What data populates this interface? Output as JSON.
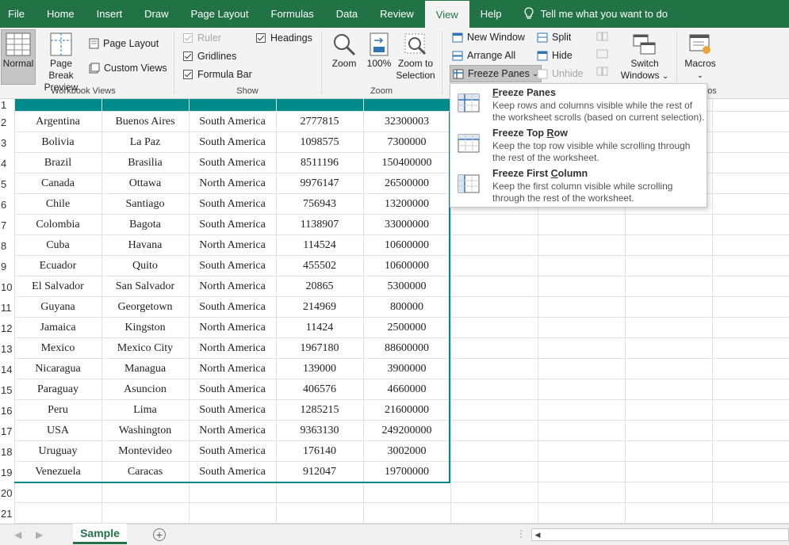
{
  "tabs": [
    "File",
    "Home",
    "Insert",
    "Draw",
    "Page Layout",
    "Formulas",
    "Data",
    "Review",
    "View",
    "Help"
  ],
  "active_tab": "View",
  "tell_me": "Tell me what you want to do",
  "ribbon": {
    "workbook_views": {
      "label": "Workbook Views",
      "normal": "Normal",
      "page_break_1": "Page Break",
      "page_break_2": "Preview",
      "page_layout": "Page Layout",
      "custom_views": "Custom Views"
    },
    "show": {
      "label": "Show",
      "ruler": "Ruler",
      "gridlines": "Gridlines",
      "formula_bar": "Formula Bar",
      "headings": "Headings"
    },
    "zoom": {
      "label": "Zoom",
      "zoom": "Zoom",
      "hundred": "100%",
      "zoom_sel_1": "Zoom to",
      "zoom_sel_2": "Selection"
    },
    "window": {
      "new_window": "New Window",
      "arrange_all": "Arrange All",
      "freeze_panes": "Freeze Panes",
      "split": "Split",
      "hide": "Hide",
      "unhide": "Unhide",
      "switch_1": "Switch",
      "switch_2": "Windows",
      "chevron": "⌄"
    },
    "macros": {
      "label_partial": "os",
      "macros": "Macros",
      "chevron": "⌄"
    }
  },
  "dropdown": [
    {
      "title": "Freeze Panes",
      "underline_char": "F",
      "title_rest": "reeze Panes",
      "desc": "Keep rows and columns visible while the rest of the worksheet scrolls (based on current selection)."
    },
    {
      "title": "Freeze Top Row",
      "title_pre": "Freeze Top ",
      "underline_char": "R",
      "title_rest": "ow",
      "desc": "Keep the top row visible while scrolling through the rest of the worksheet."
    },
    {
      "title": "Freeze First Column",
      "title_pre": "Freeze First ",
      "underline_char": "C",
      "title_rest": "olumn",
      "desc": "Keep the first column visible while scrolling through the rest of the worksheet."
    }
  ],
  "row_numbers": [
    "1",
    "2",
    "3",
    "4",
    "5",
    "6",
    "7",
    "8",
    "9",
    "10",
    "11",
    "12",
    "13",
    "14",
    "15",
    "16",
    "17",
    "18",
    "19",
    "20",
    "21"
  ],
  "rows": [
    [
      "Argentina",
      "Buenos Aires",
      "South America",
      "2777815",
      "32300003"
    ],
    [
      "Bolivia",
      "La Paz",
      "South America",
      "1098575",
      "7300000"
    ],
    [
      "Brazil",
      "Brasilia",
      "South America",
      "8511196",
      "150400000"
    ],
    [
      "Canada",
      "Ottawa",
      "North America",
      "9976147",
      "26500000"
    ],
    [
      "Chile",
      "Santiago",
      "South America",
      "756943",
      "13200000"
    ],
    [
      "Colombia",
      "Bagota",
      "South America",
      "1138907",
      "33000000"
    ],
    [
      "Cuba",
      "Havana",
      "North America",
      "114524",
      "10600000"
    ],
    [
      "Ecuador",
      "Quito",
      "South America",
      "455502",
      "10600000"
    ],
    [
      "El Salvador",
      "San Salvador",
      "North America",
      "20865",
      "5300000"
    ],
    [
      "Guyana",
      "Georgetown",
      "South America",
      "214969",
      "800000"
    ],
    [
      "Jamaica",
      "Kingston",
      "North America",
      "11424",
      "2500000"
    ],
    [
      "Mexico",
      "Mexico City",
      "North America",
      "1967180",
      "88600000"
    ],
    [
      "Nicaragua",
      "Managua",
      "North America",
      "139000",
      "3900000"
    ],
    [
      "Paraguay",
      "Asuncion",
      "South America",
      "406576",
      "4660000"
    ],
    [
      "Peru",
      "Lima",
      "South America",
      "1285215",
      "21600000"
    ],
    [
      "USA",
      "Washington",
      "North America",
      "9363130",
      "249200000"
    ],
    [
      "Uruguay",
      "Montevideo",
      "South America",
      "176140",
      "3002000"
    ],
    [
      "Venezuela",
      "Caracas",
      "South America",
      "912047",
      "19700000"
    ]
  ],
  "sheet_tab": "Sample",
  "add_sheet": "+",
  "nav_left": "◀",
  "nav_right": "▶",
  "sheet_dots": "⋮",
  "scroll_left": "◀",
  "colors": {
    "ribbon": "#217346",
    "header_band": "#008b8b"
  }
}
